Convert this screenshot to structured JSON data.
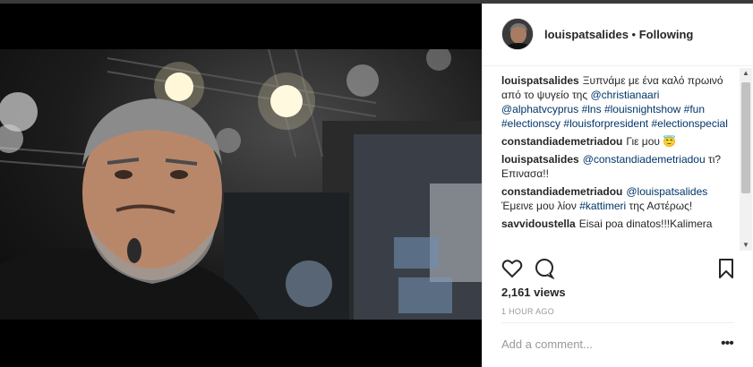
{
  "post": {
    "username": "louispatsalides",
    "separator": " • ",
    "follow_status": "Following"
  },
  "comments": [
    {
      "user": "louispatsalides",
      "parts": [
        {
          "t": "Ξυπνάμε με ένα καλό πρωινό από το ψυγείο της ",
          "link": false
        },
        {
          "t": "@christianaari",
          "link": true
        },
        {
          "t": " ",
          "link": false
        },
        {
          "t": "@alphatvcyprus",
          "link": true
        },
        {
          "t": " ",
          "link": false
        },
        {
          "t": "#lns",
          "link": true
        },
        {
          "t": " ",
          "link": false
        },
        {
          "t": "#louisnightshow",
          "link": true
        },
        {
          "t": " ",
          "link": false
        },
        {
          "t": "#fun",
          "link": true
        },
        {
          "t": " ",
          "link": false
        },
        {
          "t": "#electionscy",
          "link": true
        },
        {
          "t": " ",
          "link": false
        },
        {
          "t": "#louisforpresident",
          "link": true
        },
        {
          "t": " ",
          "link": false
        },
        {
          "t": "#electionspecial",
          "link": true
        }
      ]
    },
    {
      "user": "constandiademetriadou",
      "parts": [
        {
          "t": "Γιε μου 😇",
          "link": false
        }
      ]
    },
    {
      "user": "louispatsalides",
      "parts": [
        {
          "t": "@constandiademetriadou",
          "link": true
        },
        {
          "t": " τι? Επινασα!!",
          "link": false
        }
      ]
    },
    {
      "user": "constandiademetriadou",
      "parts": [
        {
          "t": "@louispatsalides",
          "link": true
        },
        {
          "t": " Έμεινε μου λίον ",
          "link": false
        },
        {
          "t": "#kattimeri",
          "link": true
        },
        {
          "t": " της Αστέρως!",
          "link": false
        }
      ]
    },
    {
      "user": "savvidoustella",
      "parts": [
        {
          "t": "Eisai poa dinatos!!!Kalimera",
          "link": false
        }
      ]
    }
  ],
  "icons": {
    "like": "heart-icon",
    "comment": "speech-bubble-icon",
    "save": "bookmark-icon",
    "more": "more-options-icon"
  },
  "stats": {
    "views": "2,161 views",
    "time": "1 HOUR AGO"
  },
  "compose": {
    "placeholder": "Add a comment...",
    "more_glyph": "•••"
  },
  "colors": {
    "link": "#003569",
    "text": "#262626",
    "muted": "#999999"
  }
}
